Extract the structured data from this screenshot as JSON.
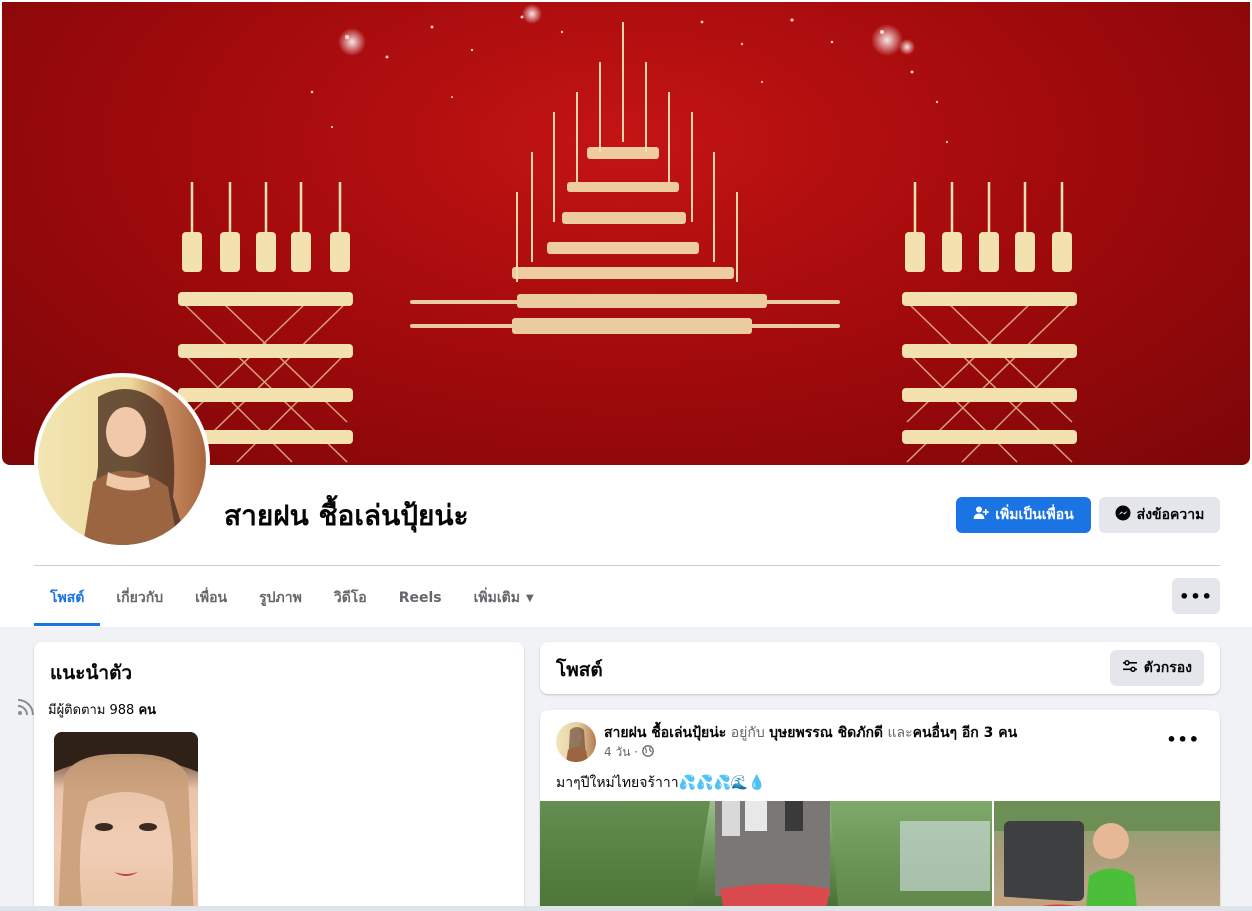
{
  "profile": {
    "name": "สายฝน ชื้อเล่นปุ้ยน่ะ",
    "add_friend_label": "เพิ่มเป็นเพื่อน",
    "message_label": "ส่งข้อความ"
  },
  "tabs": [
    {
      "label": "โพสต์",
      "active": true
    },
    {
      "label": "เกี่ยวกับ"
    },
    {
      "label": "เพื่อน"
    },
    {
      "label": "รูปภาพ"
    },
    {
      "label": "วิดีโอ"
    },
    {
      "label": "Reels"
    },
    {
      "label": "เพิ่มเติม"
    }
  ],
  "more_label": "•••",
  "intro": {
    "title": "แนะนำตัว",
    "followers_prefix": "มีผู้ติดตาม 988",
    "followers_unit": "คน"
  },
  "posts": {
    "title": "โพสต์",
    "filter_label": "ตัวกรอง"
  },
  "post": {
    "author": "สายฝน ชื้อเล่นปุ้ยน่ะ",
    "with_word": "อยู่กับ",
    "tagged": "บุษยพรรณ ชิดภักดี",
    "and_word": "และ",
    "others": "คนอื่นๆ อีก 3 คน",
    "time": "4 วัน ·",
    "text": "มาๆปีใหม่ไทยจร้าาา",
    "text_emoji": "💦💦💦🌊💧",
    "more": "•••"
  },
  "colors": {
    "accent": "#1b74e4",
    "cover_red": "#b30d10",
    "gold": "#f3e1b0"
  }
}
